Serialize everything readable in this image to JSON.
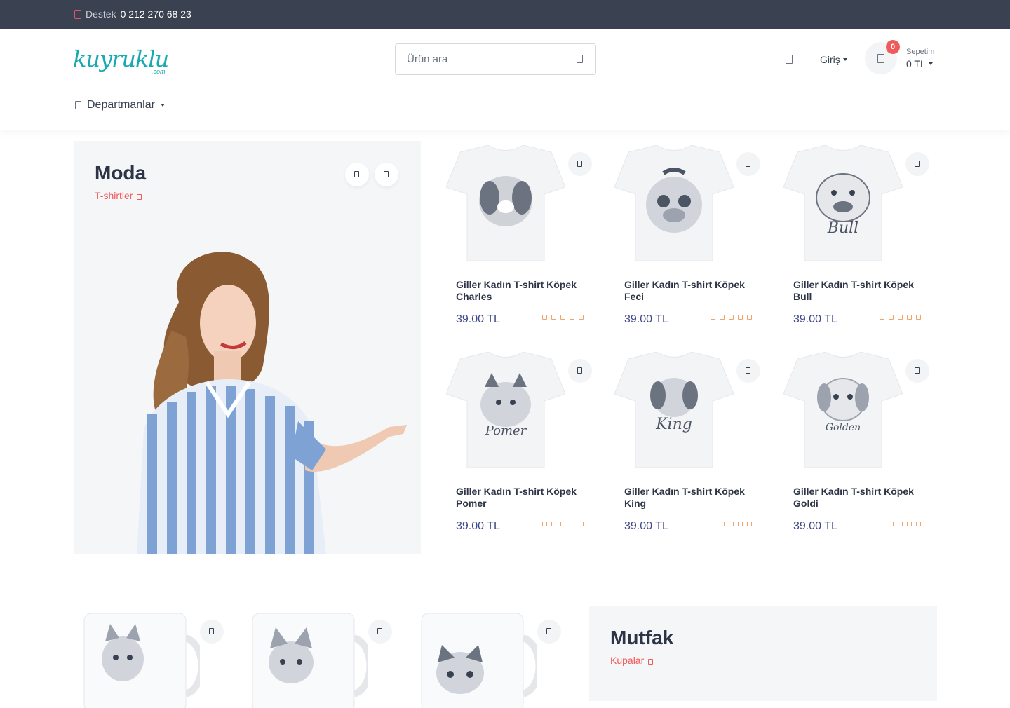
{
  "topbar": {
    "support_label": "Destek",
    "support_phone": "0 212 270 68 23"
  },
  "header": {
    "logo_text": "kuyruklu",
    "logo_sub": ".com",
    "search_placeholder": "Ürün ara",
    "login_label": "Giriş",
    "cart_count": "0",
    "cart_label": "Sepetim",
    "cart_total": "0 TL",
    "departments_label": "Departmanlar"
  },
  "moda": {
    "title": "Moda",
    "link": "T-shirtler",
    "products": [
      {
        "name": "Giller Kadın T-shirt Köpek Charles",
        "price": "39.00 TL",
        "print": ""
      },
      {
        "name": "Giller Kadın T-shirt Köpek Feci",
        "price": "39.00 TL",
        "print": ""
      },
      {
        "name": "Giller Kadın T-shirt Köpek Bull",
        "price": "39.00 TL",
        "print": "Bull"
      },
      {
        "name": "Giller Kadın T-shirt Köpek Pomer",
        "price": "39.00 TL",
        "print": "Pomer"
      },
      {
        "name": "Giller Kadın T-shirt Köpek King",
        "price": "39.00 TL",
        "print": "King"
      },
      {
        "name": "Giller Kadın T-shirt Köpek Goldi",
        "price": "39.00 TL",
        "print": "Golden"
      }
    ],
    "rating": 0
  },
  "mutfak": {
    "title": "Mutfak",
    "link": "Kupalar"
  },
  "colors": {
    "accent": "#f05a5a",
    "brand": "#18aab0",
    "price": "#3d4785",
    "topbar": "#3a4150"
  }
}
